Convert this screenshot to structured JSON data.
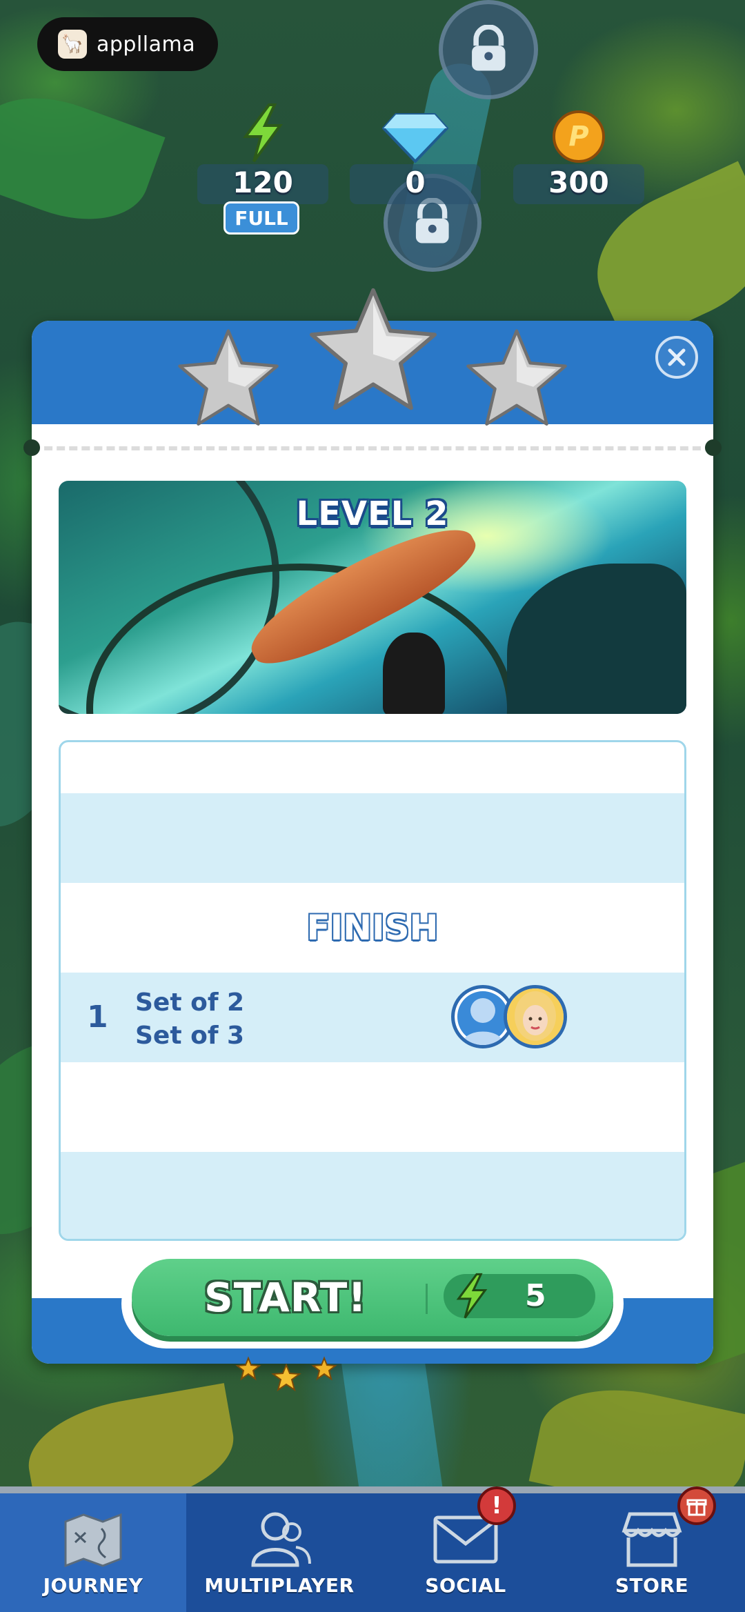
{
  "brand": {
    "name": "appllama"
  },
  "resources": {
    "energy": {
      "value": "120",
      "badge": "FULL"
    },
    "gems": {
      "value": "0"
    },
    "coins": {
      "value": "300",
      "symbol": "P"
    }
  },
  "modal": {
    "level_title": "LEVEL 2",
    "finish_label": "FINISH",
    "leaderboard": [
      {
        "rank": "1",
        "line1": "Set of 2",
        "line2": "Set of 3"
      }
    ],
    "start": {
      "label": "START!",
      "cost": "5"
    }
  },
  "nav": {
    "items": [
      {
        "label": "JOURNEY",
        "icon": "map-icon",
        "active": true
      },
      {
        "label": "MULTIPLAYER",
        "icon": "users-icon"
      },
      {
        "label": "SOCIAL",
        "icon": "mail-icon",
        "alert": "!"
      },
      {
        "label": "STORE",
        "icon": "store-icon"
      }
    ]
  },
  "colors": {
    "modal_blue": "#2a78c8",
    "start_green": "#3eb86f",
    "nav_blue": "#1c4e9a",
    "alert_red": "#d33a3a"
  }
}
